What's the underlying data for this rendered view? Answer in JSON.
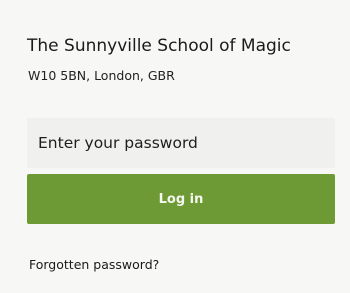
{
  "school": {
    "name": "The Sunnyville School of Magic",
    "address": "W10 5BN, London, GBR"
  },
  "login_form": {
    "password_placeholder": "Enter your password",
    "password_value": "",
    "login_label": "Log in",
    "forgot_label": "Forgotten password?"
  },
  "colors": {
    "background": "#f7f7f5",
    "input_background": "#f0f0ee",
    "button_green": "#6e9a35",
    "text": "#1a1a1a"
  }
}
